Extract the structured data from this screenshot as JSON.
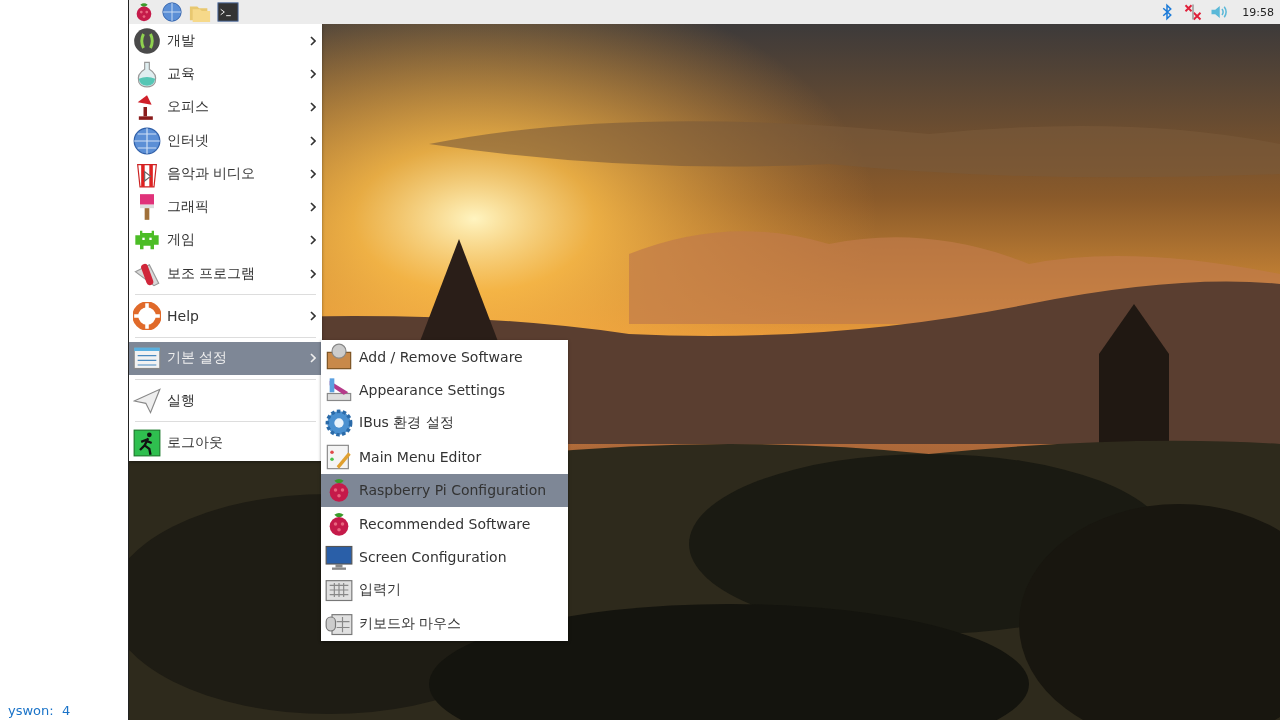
{
  "side_note": {
    "user": "yswon:",
    "count": "4"
  },
  "taskbar": {
    "clock": "19:58"
  },
  "menu": {
    "items": [
      {
        "kind": "item",
        "label": "개발",
        "submenu": true,
        "selected": false
      },
      {
        "kind": "item",
        "label": "교육",
        "submenu": true,
        "selected": false
      },
      {
        "kind": "item",
        "label": "오피스",
        "submenu": true,
        "selected": false
      },
      {
        "kind": "item",
        "label": "인터넷",
        "submenu": true,
        "selected": false
      },
      {
        "kind": "item",
        "label": "음악과 비디오",
        "submenu": true,
        "selected": false
      },
      {
        "kind": "item",
        "label": "그래픽",
        "submenu": true,
        "selected": false
      },
      {
        "kind": "item",
        "label": "게임",
        "submenu": true,
        "selected": false
      },
      {
        "kind": "item",
        "label": "보조 프로그램",
        "submenu": true,
        "selected": false
      },
      {
        "kind": "separator"
      },
      {
        "kind": "item",
        "label": "Help",
        "submenu": true,
        "selected": false
      },
      {
        "kind": "separator"
      },
      {
        "kind": "item",
        "label": "기본 설정",
        "submenu": true,
        "selected": true
      },
      {
        "kind": "separator"
      },
      {
        "kind": "item",
        "label": "실행",
        "submenu": false,
        "selected": false
      },
      {
        "kind": "separator"
      },
      {
        "kind": "item",
        "label": "로그아웃",
        "submenu": false,
        "selected": false
      }
    ]
  },
  "submenu": {
    "items": [
      {
        "label": "Add / Remove Software",
        "selected": false
      },
      {
        "label": "Appearance Settings",
        "selected": false
      },
      {
        "label": "IBus 환경 설정",
        "selected": false
      },
      {
        "label": "Main Menu Editor",
        "selected": false
      },
      {
        "label": "Raspberry Pi Configuration",
        "selected": true
      },
      {
        "label": "Recommended Software",
        "selected": false
      },
      {
        "label": "Screen Configuration",
        "selected": false
      },
      {
        "label": "입력기",
        "selected": false
      },
      {
        "label": "키보드와 마우스",
        "selected": false
      }
    ]
  }
}
